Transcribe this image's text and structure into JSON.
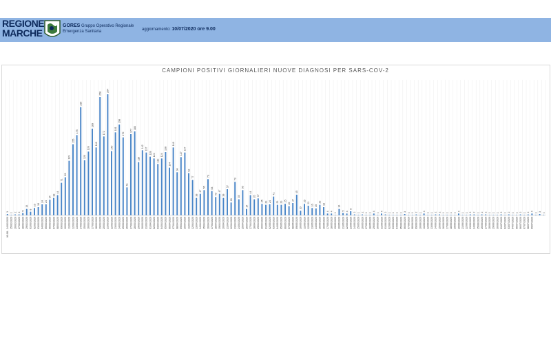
{
  "header": {
    "logo_line1": "REGIONE",
    "logo_line2": "MARCHE",
    "org_short": "GORES",
    "org_line1": "Gruppo Operativo Regionale",
    "org_line2": "Emergenza Sanitaria",
    "update_label": "aggiornamento:",
    "update_value": "10/07/2020 ore 9.00",
    "bg_color": "#8fb4e3"
  },
  "chart_data": {
    "type": "bar",
    "title": "CAMPIONI POSITIVI GIORNALIERI NUOVE DIAGNOSI PER SARS-COV-2",
    "xlabel": "",
    "ylabel": "",
    "grid": true,
    "legend": "none",
    "bar_color": "#4a86c8",
    "categories": [
      "06-08 - 24/02/2020",
      "25/02/2020",
      "26/02/2020",
      "27/02/2020",
      "28/02/2020",
      "29/02/2020",
      "01/03/2020",
      "02/03/2020",
      "03/03/2020",
      "04/03/2020",
      "05/03/2020",
      "06/03/2020",
      "07/03/2020",
      "08/03/2020",
      "09/03/2020",
      "10/03/2020",
      "11/03/2020",
      "12/03/2020",
      "13/03/2020",
      "14/03/2020",
      "15/03/2020",
      "16/03/2020",
      "17/03/2020",
      "18/03/2020",
      "19/03/2020",
      "20/03/2020",
      "21/03/2020",
      "22/03/2020",
      "23/03/2020",
      "24/03/2020",
      "25/03/2020",
      "26/03/2020",
      "27/03/2020",
      "28/03/2020",
      "29/03/2020",
      "30/03/2020",
      "31/03/2020",
      "01/04/2020",
      "02/04/2020",
      "03/04/2020",
      "04/04/2020",
      "05/04/2020",
      "06/04/2020",
      "07/04/2020",
      "08/04/2020",
      "09/04/2020",
      "10/04/2020",
      "11/04/2020",
      "12/04/2020",
      "13/04/2020",
      "14/04/2020",
      "15/04/2020",
      "16/04/2020",
      "17/04/2020",
      "18/04/2020",
      "19/04/2020",
      "20/04/2020",
      "21/04/2020",
      "22/04/2020",
      "23/04/2020",
      "24/04/2020",
      "25/04/2020",
      "26/04/2020",
      "27/04/2020",
      "28/04/2020",
      "29/04/2020",
      "30/04/2020",
      "01/05/2020",
      "02/05/2020",
      "03/05/2020",
      "04/05/2020",
      "05/05/2020",
      "06/05/2020",
      "07/05/2020",
      "08/05/2020",
      "09/05/2020",
      "10/05/2020",
      "11/05/2020",
      "12/05/2020",
      "13/05/2020",
      "14/05/2020",
      "15/05/2020",
      "16/05/2020",
      "17/05/2020",
      "18/05/2020",
      "19/05/2020",
      "20/05/2020",
      "21/05/2020",
      "22/05/2020",
      "23/05/2020",
      "24/05/2020",
      "25/05/2020",
      "26/05/2020",
      "27/05/2020",
      "28/05/2020",
      "29/05/2020",
      "30/05/2020",
      "31/05/2020",
      "01/06/2020",
      "02/06/2020",
      "03/06/2020",
      "04/06/2020",
      "05/06/2020",
      "06/06/2020",
      "07/06/2020",
      "08/06/2020",
      "09/06/2020",
      "10/06/2020",
      "11/06/2020",
      "12/06/2020",
      "13/06/2020",
      "14/06/2020",
      "15/06/2020",
      "16/06/2020",
      "17/06/2020",
      "18/06/2020",
      "19/06/2020",
      "20/06/2020",
      "21/06/2020",
      "22/06/2020",
      "23/06/2020",
      "24/06/2020",
      "25/06/2020",
      "26/06/2020",
      "27/06/2020",
      "28/06/2020",
      "29/06/2020",
      "30/06/2020",
      "01/07/2020",
      "02/07/2020",
      "03/07/2020",
      "04/07/2020",
      "05/07/2020",
      "06/07/2020",
      "07/07/2020",
      "08/07/2020",
      "09/07/2020"
    ],
    "values": [
      3,
      1,
      2,
      2,
      5,
      14,
      8,
      16,
      18,
      24,
      24,
      34,
      38,
      44,
      71,
      83,
      119,
      155,
      175,
      236,
      120,
      139,
      189,
      148,
      258,
      172,
      264,
      140,
      181,
      198,
      170,
      61,
      177,
      183,
      116,
      142,
      137,
      128,
      124,
      112,
      124,
      138,
      104,
      148,
      94,
      127,
      137,
      92,
      77,
      38,
      47,
      55,
      79,
      53,
      40,
      47,
      38,
      57,
      28,
      73,
      35,
      55,
      14,
      44,
      35,
      37,
      25,
      23,
      24,
      41,
      23,
      23,
      25,
      20,
      27,
      45,
      10,
      25,
      21,
      16,
      15,
      23,
      18,
      4,
      4,
      1,
      14,
      5,
      4,
      9,
      2,
      1,
      2,
      1,
      1,
      4,
      1,
      4,
      2,
      1,
      1,
      1,
      1,
      3,
      1,
      1,
      2,
      1,
      4,
      1,
      1,
      2,
      2,
      1,
      1,
      1,
      1,
      4,
      1,
      1,
      2,
      2,
      1,
      2,
      2,
      1,
      1,
      1,
      2,
      1,
      2,
      1,
      1,
      2,
      1,
      2,
      4,
      1,
      3,
      1
    ]
  }
}
